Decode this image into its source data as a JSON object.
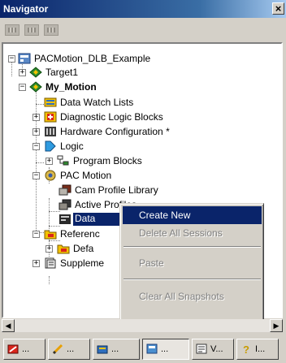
{
  "window": {
    "title": "Navigator",
    "close_glyph": "×"
  },
  "toolbar": {
    "buttons": [
      "grid-view-icon",
      "image-view-icon",
      "list-view-icon"
    ]
  },
  "tree": {
    "items": [
      {
        "label": "PACMotion_DLB_Example",
        "icon": "project-icon"
      },
      {
        "label": "Target1",
        "icon": "target-icon"
      },
      {
        "label": "My_Motion",
        "icon": "target-icon"
      },
      {
        "label": "Data Watch Lists",
        "icon": "data-watch-icon"
      },
      {
        "label": "Diagnostic Logic Blocks",
        "icon": "diagnostic-icon"
      },
      {
        "label": "Hardware Configuration *",
        "icon": "hardware-icon"
      },
      {
        "label": "Logic",
        "icon": "logic-icon"
      },
      {
        "label": "Program Blocks",
        "icon": "program-blocks-icon"
      },
      {
        "label": "PAC Motion",
        "icon": "pac-motion-icon"
      },
      {
        "label": "Cam Profile Library",
        "icon": "cam-profile-icon"
      },
      {
        "label": "Active Profiles",
        "icon": "active-profile-icon"
      },
      {
        "label": "Data",
        "icon": "data-window-icon"
      },
      {
        "label": "Referenc",
        "icon": "folder-icon"
      },
      {
        "label": "Defa",
        "icon": "folder-icon"
      },
      {
        "label": "Suppleme",
        "icon": "supplement-icon"
      }
    ]
  },
  "context_menu": {
    "items": [
      {
        "label": "Create New",
        "state": "highlighted"
      },
      {
        "label": "Delete All Sessions",
        "state": "disabled"
      },
      {
        "label": "Paste",
        "state": "disabled"
      },
      {
        "label": "Clear All Snapshots",
        "state": "disabled"
      }
    ]
  },
  "scrollbar": {
    "left_arrow": "◀",
    "right_arrow": "▶"
  },
  "tabs": [
    {
      "label": "...",
      "icon": "project-tab-icon"
    },
    {
      "label": "...",
      "icon": "pencil-icon"
    },
    {
      "label": "...",
      "icon": "toolchest-icon"
    },
    {
      "label": "...",
      "icon": "navigator-icon"
    },
    {
      "label": "V...",
      "icon": "variables-icon"
    },
    {
      "label": "I...",
      "icon": "help-icon"
    }
  ],
  "colors": {
    "selection": "#0a246a",
    "titlebar": "#0a246a",
    "face": "#d4d0c8"
  }
}
